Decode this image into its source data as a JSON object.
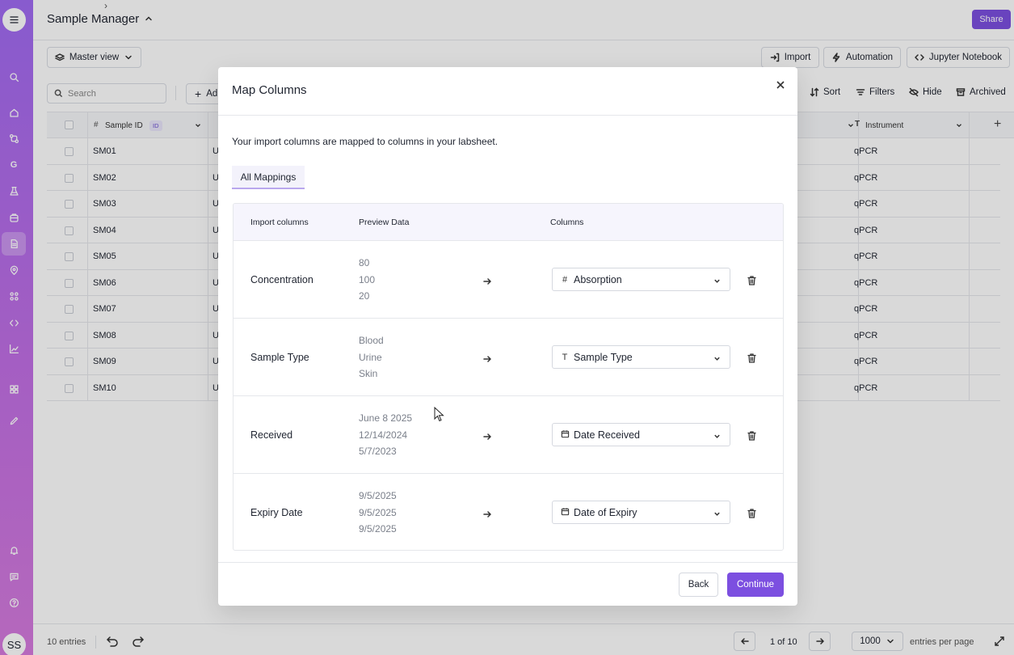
{
  "header": {
    "title": "Sample Manager",
    "share_label": "Share"
  },
  "view": {
    "label": "Master view"
  },
  "actions": {
    "import_label": "Import",
    "automation_label": "Automation",
    "jupyter_label": "Jupyter Notebook"
  },
  "search": {
    "placeholder": "Search"
  },
  "toolbar": {
    "add_label": "Ad",
    "sort_label": "Sort",
    "filters_label": "Filters",
    "hide_label": "Hide",
    "archived_label": "Archived"
  },
  "grid": {
    "col_sample_id": "Sample ID",
    "col_sample_id_badge": "ID",
    "col_instrument": "Instrument",
    "rows": [
      {
        "id": "SM01",
        "partial": "U",
        "instrument": "qPCR"
      },
      {
        "id": "SM02",
        "partial": "U",
        "instrument": "qPCR"
      },
      {
        "id": "SM03",
        "partial": "U",
        "instrument": "qPCR"
      },
      {
        "id": "SM04",
        "partial": "U",
        "instrument": "qPCR"
      },
      {
        "id": "SM05",
        "partial": "U",
        "instrument": "qPCR"
      },
      {
        "id": "SM06",
        "partial": "U",
        "instrument": "qPCR"
      },
      {
        "id": "SM07",
        "partial": "U",
        "instrument": "qPCR"
      },
      {
        "id": "SM08",
        "partial": "U",
        "instrument": "qPCR"
      },
      {
        "id": "SM09",
        "partial": "U",
        "instrument": "qPCR"
      },
      {
        "id": "SM10",
        "partial": "U",
        "instrument": "qPCR"
      }
    ]
  },
  "footer": {
    "entries": "10 entries",
    "page": "1 of 10",
    "per_page_value": "1000",
    "per_page_label": "entries per page"
  },
  "sidebar": {
    "avatar": "SS",
    "g_label": "G"
  },
  "modal": {
    "title": "Map Columns",
    "description": "Your import columns are mapped to columns in your labsheet.",
    "tab": "All Mappings",
    "headers": {
      "import_columns": "Import columns",
      "preview": "Preview Data",
      "columns": "Columns"
    },
    "mappings": [
      {
        "import": "Concentration",
        "preview": [
          "80",
          "100",
          "20"
        ],
        "target_icon": "#",
        "target": "Absorption"
      },
      {
        "import": "Sample Type",
        "preview": [
          "Blood",
          "Urine",
          "Skin"
        ],
        "target_icon": "T",
        "target": "Sample Type"
      },
      {
        "import": "Received",
        "preview": [
          "June 8 2025",
          "12/14/2024",
          "5/7/2023"
        ],
        "target_icon": "calendar",
        "target": "Date Received"
      },
      {
        "import": "Expiry Date",
        "preview": [
          "9/5/2025",
          "9/5/2025",
          "9/5/2025"
        ],
        "target_icon": "calendar",
        "target": "Date of Expiry"
      }
    ],
    "back_label": "Back",
    "continue_label": "Continue"
  },
  "colors": {
    "accent": "#7c4fe0",
    "sidebar_top": "#a06bf2",
    "sidebar_bottom": "#d67bde"
  }
}
